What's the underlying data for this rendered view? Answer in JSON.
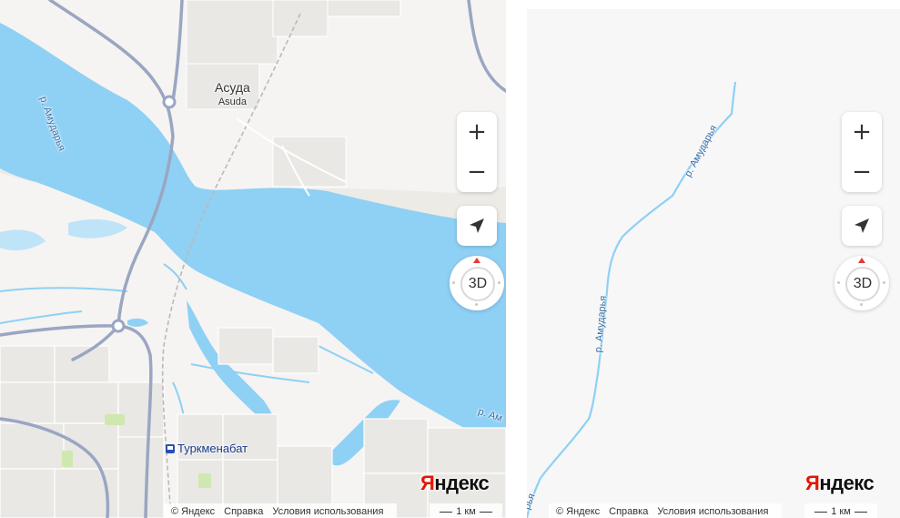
{
  "colors": {
    "land": "#f5f4f2",
    "water": "#8fd0f5",
    "road": "#9aa6c2",
    "minor_road": "#ffffff",
    "sandbank": "#ecebe6",
    "park": "#cfe8b0",
    "logo_red": "#e61400"
  },
  "left_map": {
    "place_label": "Асуда",
    "place_label_latin": "Asuda",
    "city_label": "Туркменабат",
    "city_icon": "railway-station-icon",
    "river_label_upper": "р. Амударья",
    "river_label_lower": "р. Ам",
    "zoom_in": "+",
    "zoom_out": "−",
    "locate_icon": "navigation-arrow-icon",
    "compass_label": "3D",
    "logo_first": "Я",
    "logo_rest": "ндекс",
    "footer": {
      "copyright": "© Яндекс",
      "help": "Справка",
      "terms": "Условия использования"
    },
    "scale_label": "1 км"
  },
  "right_map": {
    "river_label_upper": "р. Амударья",
    "river_label_middle": "р. Амударья",
    "river_label_lower": "рья",
    "zoom_in": "+",
    "zoom_out": "−",
    "locate_icon": "navigation-arrow-icon",
    "compass_label": "3D",
    "logo_first": "Я",
    "logo_rest": "ндекс",
    "footer": {
      "copyright": "© Яндекс",
      "help": "Справка",
      "terms": "Условия использования"
    },
    "scale_label": "1 км"
  }
}
